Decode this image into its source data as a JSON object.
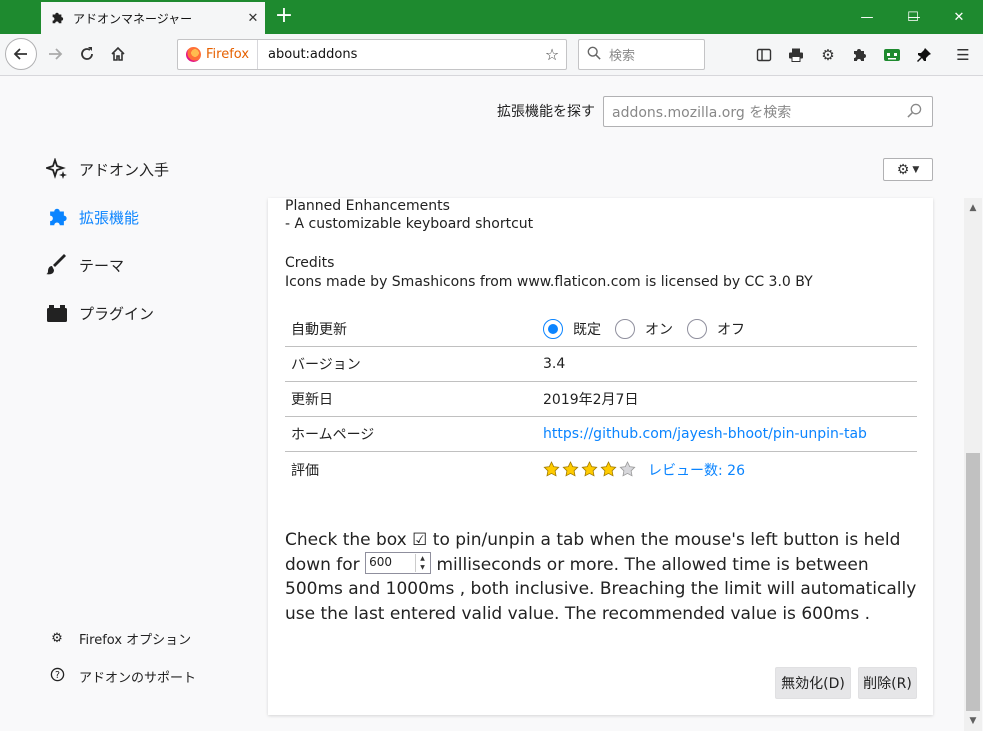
{
  "window": {
    "tab_title": "アドオンマネージャー",
    "minimize": "—",
    "maximize": "☐",
    "close": "✕",
    "accent": "#1e8a2f"
  },
  "navbar": {
    "identity_label": "Firefox",
    "url": "about:addons",
    "search_placeholder": "検索"
  },
  "header": {
    "find_label": "拡張機能を探す",
    "find_placeholder": "addons.mozilla.org を検索"
  },
  "sidebar": {
    "items": [
      {
        "label": "アドオン入手",
        "icon": "discover-icon"
      },
      {
        "label": "拡張機能",
        "icon": "puzzle-icon",
        "active": true
      },
      {
        "label": "テーマ",
        "icon": "brush-icon"
      },
      {
        "label": "プラグイン",
        "icon": "plugin-icon"
      }
    ],
    "footer": [
      {
        "label": "Firefox オプション",
        "icon": "gear-icon"
      },
      {
        "label": "アドオンのサポート",
        "icon": "help-icon"
      }
    ]
  },
  "detail": {
    "desc_lines": [
      "Planned Enhancements",
      "- A customizable keyboard shortcut",
      "Credits",
      "Icons made by Smashicons from www.flaticon.com is licensed by CC 3.0 BY"
    ],
    "auto_update": {
      "label": "自動更新",
      "options": [
        "既定",
        "オン",
        "オフ"
      ],
      "selected": "既定"
    },
    "version": {
      "label": "バージョン",
      "value": "3.4"
    },
    "updated": {
      "label": "更新日",
      "value": "2019年2月7日"
    },
    "homepage": {
      "label": "ホームページ",
      "value": "https://github.com/jayesh-bhoot/pin-unpin-tab"
    },
    "rating": {
      "label": "評価",
      "stars": 4,
      "max": 5,
      "reviews": "レビュー数: 26"
    }
  },
  "preferences": {
    "part1": "Check the box ☑ to pin/unpin a tab when the mouse's left button is held down for ",
    "duration_value": "600",
    "part2": " milliseconds or more. The allowed time is between 500ms and 1000ms , both inclusive. Breaching the limit will automatically use the last entered valid value. The recommended value is 600ms ."
  },
  "actions": {
    "disable_label": "無効化(D)",
    "remove_label": "削除(R)"
  },
  "colors": {
    "link": "#0a84ff",
    "star": "#ffcb00",
    "titlebar": "#1e8a2f"
  }
}
